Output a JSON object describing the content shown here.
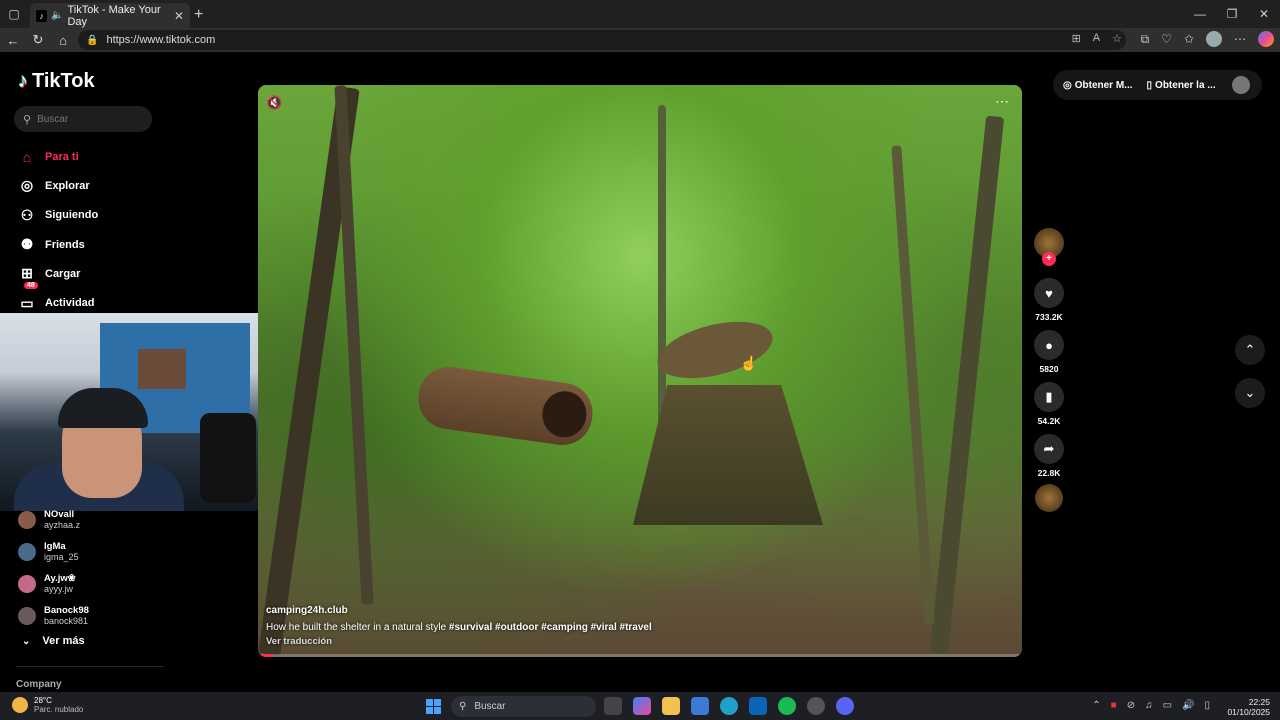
{
  "browser": {
    "tab_title": "TikTok - Make Your Day",
    "new_tab": "+",
    "url": "https://www.tiktok.com",
    "controls": {
      "minimize": "—",
      "maximize": "❐",
      "close": "✕"
    }
  },
  "sidebar": {
    "logo": "TikTok",
    "search_placeholder": "Buscar",
    "nav": [
      {
        "label": "Para ti",
        "icon": "home-icon"
      },
      {
        "label": "Explorar",
        "icon": "compass-icon"
      },
      {
        "label": "Siguiendo",
        "icon": "following-icon"
      },
      {
        "label": "Friends",
        "icon": "friends-icon"
      },
      {
        "label": "Cargar",
        "icon": "upload-icon"
      },
      {
        "label": "Actividad",
        "icon": "inbox-icon",
        "badge": "48"
      }
    ],
    "following": [
      {
        "name": "NOvall",
        "handle": "ayzhaa.z",
        "color": "#8a5a4a"
      },
      {
        "name": "IgMa",
        "handle": "igma_25",
        "color": "#4a6a8a"
      },
      {
        "name": "Ay.jw❀",
        "handle": "ayyy.jw",
        "color": "#c46a8a"
      },
      {
        "name": "Banock98",
        "handle": "banock981",
        "color": "#6a5a5a"
      }
    ],
    "ver_mas": "Ver más",
    "company": "Company"
  },
  "video": {
    "author": "camping24h.club",
    "description": "How he built the shelter in a natural style",
    "hashtags": "#survival  #outdoor  #camping  #viral  #travel",
    "translate": "Ver traducción",
    "progress": 0.02
  },
  "actions": {
    "likes": "733.2K",
    "comments": "5820",
    "saves": "54.2K",
    "shares": "22.8K"
  },
  "topright": {
    "btn1": "Obtener M...",
    "btn2": "Obtener la ..."
  },
  "taskbar": {
    "temp": "28°C",
    "weather": "Parc. nublado",
    "search": "Buscar",
    "time": "22:25",
    "date": "01/10/2025"
  }
}
